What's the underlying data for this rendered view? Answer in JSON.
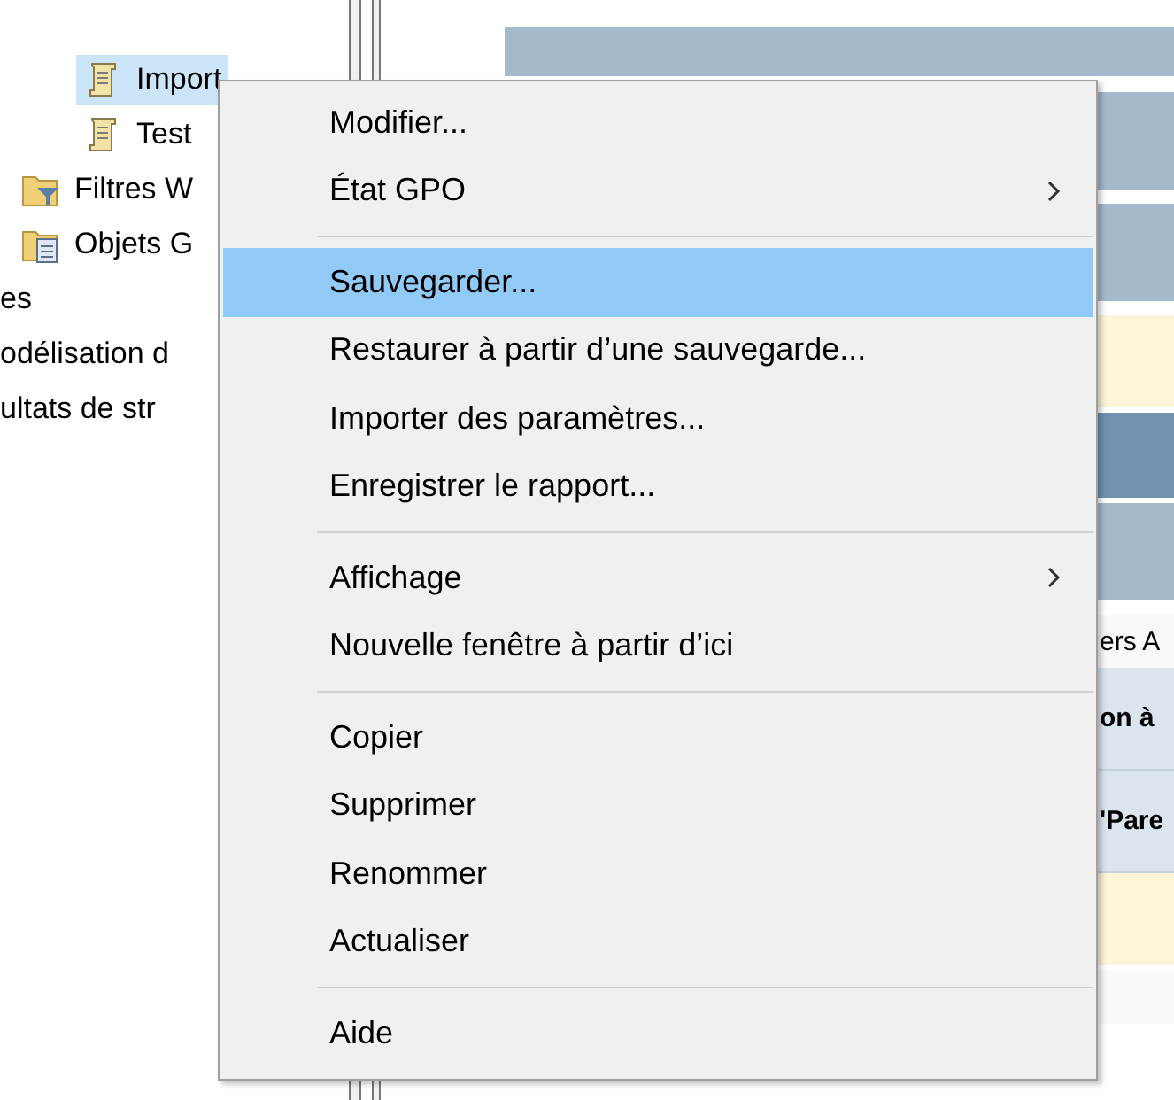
{
  "tree": [
    {
      "label": "Import",
      "kind": "scroll",
      "selected": true
    },
    {
      "label": "Test",
      "kind": "scroll",
      "selected": false
    },
    {
      "label": "Filtres W",
      "kind": "filter",
      "selected": false
    },
    {
      "label": "Objets G",
      "kind": "objects",
      "selected": false
    },
    {
      "label": "es",
      "kind": "plain",
      "selected": false
    },
    {
      "label": "odélisation d",
      "kind": "plain",
      "selected": false
    },
    {
      "label": "ultats de str",
      "kind": "plain",
      "selected": false
    }
  ],
  "right_pane": [
    {
      "kind": "header"
    },
    {
      "kind": "band"
    },
    {
      "kind": "band"
    },
    {
      "kind": "note"
    },
    {
      "kind": "dark"
    },
    {
      "kind": "band"
    },
    {
      "kind": "plain",
      "text": "ers A"
    },
    {
      "kind": "label",
      "text": "on à"
    },
    {
      "kind": "label",
      "text": "'Pare"
    },
    {
      "kind": "note"
    },
    {
      "kind": "plain"
    }
  ],
  "context_menu": [
    {
      "kind": "item",
      "label": "Modifier...",
      "submenu": false,
      "selected": false
    },
    {
      "kind": "item",
      "label": "État GPO",
      "submenu": true,
      "selected": false
    },
    {
      "kind": "separator"
    },
    {
      "kind": "item",
      "label": "Sauvegarder...",
      "submenu": false,
      "selected": true
    },
    {
      "kind": "item",
      "label": "Restaurer à partir d’une sauvegarde...",
      "submenu": false,
      "selected": false
    },
    {
      "kind": "item",
      "label": "Importer des paramètres...",
      "submenu": false,
      "selected": false
    },
    {
      "kind": "item",
      "label": "Enregistrer le rapport...",
      "submenu": false,
      "selected": false
    },
    {
      "kind": "separator"
    },
    {
      "kind": "item",
      "label": "Affichage",
      "submenu": true,
      "selected": false
    },
    {
      "kind": "item",
      "label": "Nouvelle fenêtre à partir d’ici",
      "submenu": false,
      "selected": false
    },
    {
      "kind": "separator"
    },
    {
      "kind": "item",
      "label": "Copier",
      "submenu": false,
      "selected": false
    },
    {
      "kind": "item",
      "label": "Supprimer",
      "submenu": false,
      "selected": false
    },
    {
      "kind": "item",
      "label": "Renommer",
      "submenu": false,
      "selected": false
    },
    {
      "kind": "item",
      "label": "Actualiser",
      "submenu": false,
      "selected": false
    },
    {
      "kind": "separator"
    },
    {
      "kind": "item",
      "label": "Aide",
      "submenu": false,
      "selected": false
    }
  ]
}
